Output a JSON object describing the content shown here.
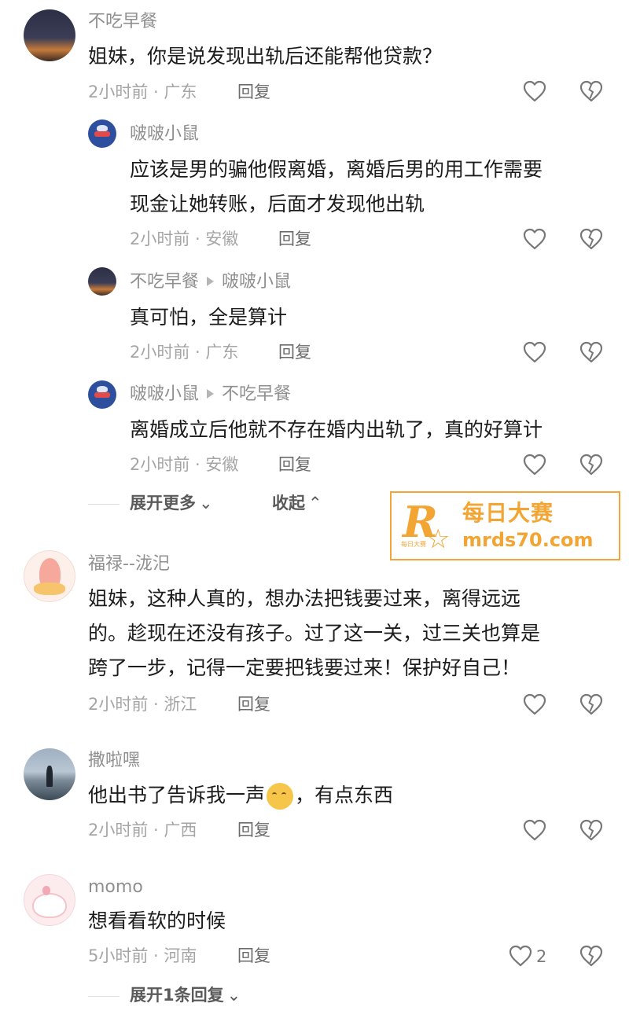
{
  "comments": [
    {
      "user": "不吃早餐",
      "lines": [
        "姐妹，你是说发现出轨后还能帮他贷款？"
      ],
      "meta": "2小时前 · 广东",
      "reply_label": "回复",
      "replies": [
        {
          "user": "啵啵小鼠",
          "lines": [
            "应该是男的骗他假离婚，离婚后男的用工作需要",
            "现金让她转账，后面才发现他出轨"
          ],
          "meta": "2小时前 · 安徽",
          "reply_label": "回复"
        },
        {
          "user": "不吃早餐",
          "reply_to": "啵啵小鼠",
          "lines": [
            "真可怕，全是算计"
          ],
          "meta": "2小时前 · 广东",
          "reply_label": "回复"
        },
        {
          "user": "啵啵小鼠",
          "reply_to": "不吃早餐",
          "lines": [
            "离婚成立后他就不存在婚内出轨了，真的好算计"
          ],
          "meta": "2小时前 · 安徽",
          "reply_label": "回复"
        }
      ],
      "expand_more": "展开更多",
      "collapse": "收起"
    },
    {
      "user": "福禄--泷汜",
      "lines": [
        "姐妹，这种人真的，想办法把钱要过来，离得远远",
        "的。趁现在还没有孩子。过了这一关，过三关也算是",
        "跨了一步，记得一定要把钱要过来！保护好自己！"
      ],
      "meta": "2小时前 · 浙江",
      "reply_label": "回复"
    },
    {
      "user": "撒啦嘿",
      "text_before_emoji": "他出书了告诉我一声",
      "text_after_emoji": "，有点东西",
      "emoji": "smirk-emoji",
      "meta": "2小时前 · 广西",
      "reply_label": "回复"
    },
    {
      "user": "momo",
      "lines": [
        "想看看软的时候"
      ],
      "meta": "5小时前 · 河南",
      "reply_label": "回复",
      "like_count": "2",
      "expand_replies": "展开1条回复"
    }
  ],
  "watermark": {
    "letter": "R",
    "name": "每日大赛",
    "small": "每日大赛",
    "url": "mrds70.com"
  },
  "icons": {
    "like": "heart-outline-icon",
    "dislike": "broken-heart-icon",
    "expand": "chevron-down-icon",
    "collapse": "chevron-up-icon"
  },
  "colors": {
    "text": "#1c1c1c",
    "meta": "#a5a5a5",
    "watermark": "#f2a533"
  }
}
